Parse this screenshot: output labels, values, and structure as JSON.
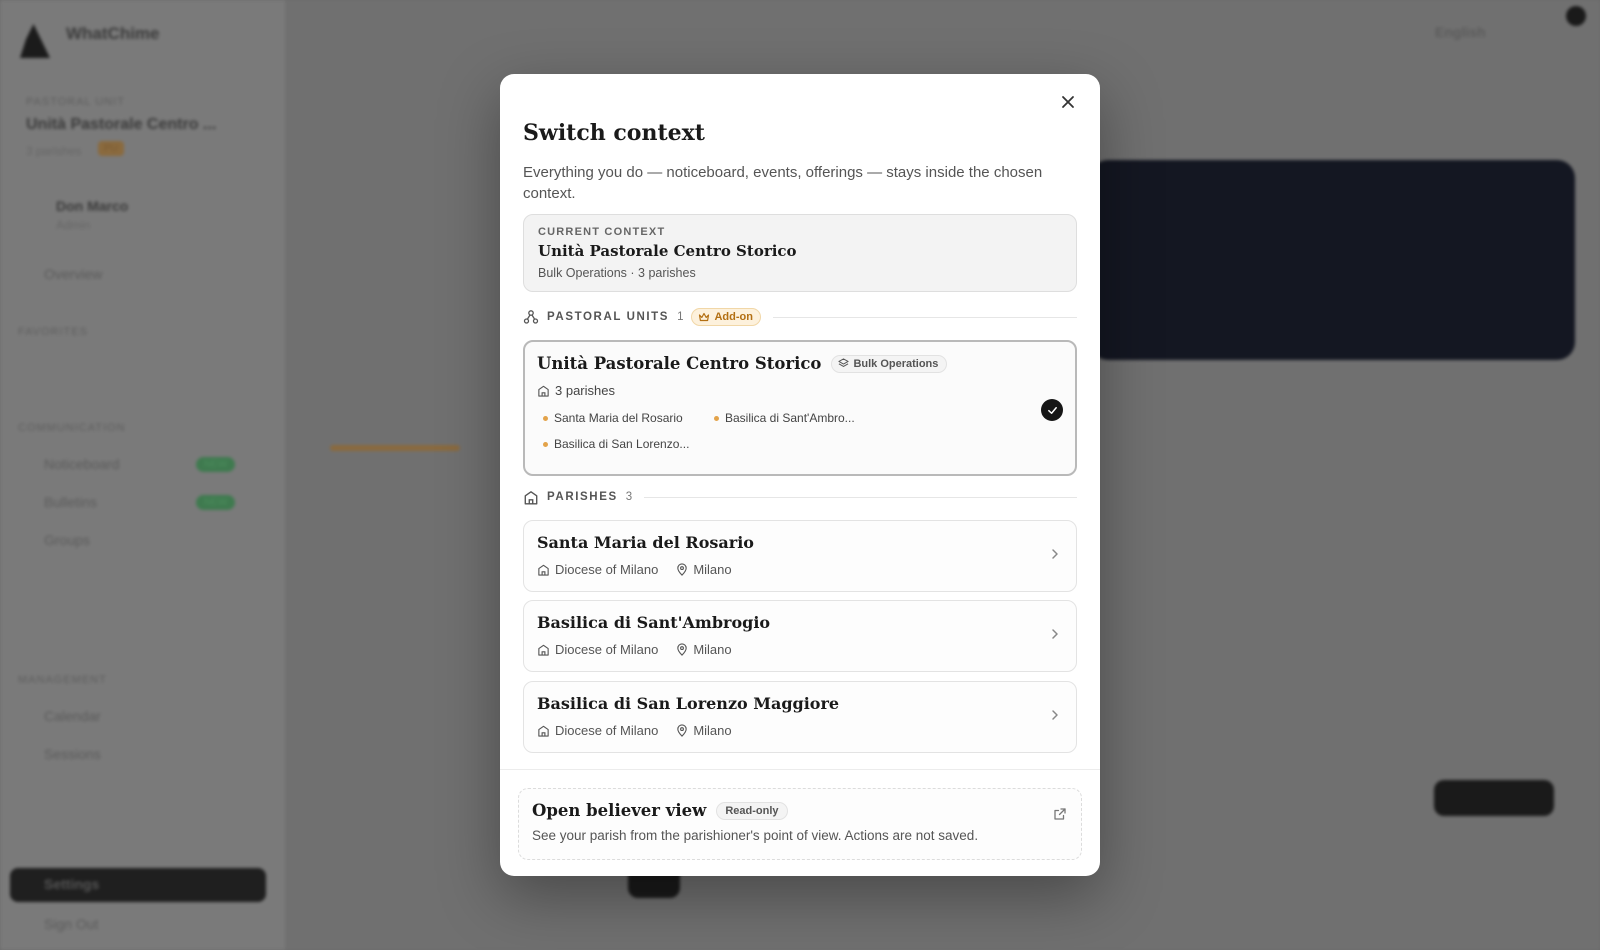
{
  "background": {
    "org_name": "WhatChime",
    "context_label": "PASTORAL UNIT",
    "context_name": "Unità Pastorale Centro ...",
    "context_meta": "3 parishes",
    "user_name": "Don Marco",
    "user_role": "Admin",
    "nav_overview": "Overview",
    "nav_favorites": "FAVORITES",
    "nav_communication": "COMMUNICATION",
    "nav_noticeboard": "Noticeboard",
    "nav_bulletins": "Bulletins",
    "nav_groups": "Groups",
    "nav_management": "MANAGEMENT",
    "nav_calendar": "Calendar",
    "nav_sessions": "Sessions",
    "nav_settings": "Settings",
    "nav_signout": "Sign Out",
    "new_badge": "NEW",
    "language": "English"
  },
  "modal": {
    "title": "Switch context",
    "description": "Everything you do — noticeboard, events, offerings — stays inside the chosen context.",
    "current": {
      "label": "CURRENT CONTEXT",
      "name": "Unità Pastorale Centro Storico",
      "meta": "Bulk Operations · 3 parishes"
    },
    "pastoral_units": {
      "label": "PASTORAL UNITS",
      "count": "1",
      "addon": "Add-on",
      "items": [
        {
          "name": "Unità Pastorale Centro Storico",
          "badge": "Bulk Operations",
          "count": "3 parishes",
          "chips": [
            "Santa Maria del Rosario",
            "Basilica di Sant'Ambro...",
            "Basilica di San Lorenzo..."
          ]
        }
      ]
    },
    "parishes": {
      "label": "PARISHES",
      "count": "3",
      "items": [
        {
          "name": "Santa Maria del Rosario",
          "diocese": "Diocese of Milano",
          "city": "Milano"
        },
        {
          "name": "Basilica di Sant'Ambrogio",
          "diocese": "Diocese of Milano",
          "city": "Milano"
        },
        {
          "name": "Basilica di San Lorenzo Maggiore",
          "diocese": "Diocese of Milano",
          "city": "Milano"
        }
      ]
    },
    "believer": {
      "title": "Open believer view",
      "badge": "Read-only",
      "description": "See your parish from the parishioner's point of view. Actions are not saved."
    }
  },
  "colors": {
    "accent_orange": "#e3a34a",
    "addon_bg": "#fdf1dc",
    "dark": "#161616"
  }
}
